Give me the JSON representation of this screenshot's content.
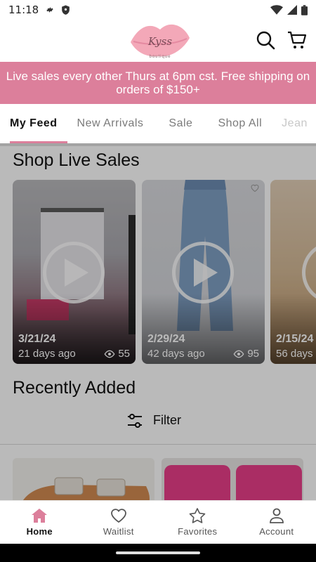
{
  "status_bar": {
    "time": "11:18"
  },
  "header": {
    "logo_text": "Kyss",
    "logo_subtext": "boutique"
  },
  "banner": {
    "text": "Live sales every other Thurs at 6pm cst. Free shipping on orders of $150+"
  },
  "tabs": [
    {
      "label": "My Feed",
      "active": true
    },
    {
      "label": "New Arrivals"
    },
    {
      "label": "Sale"
    },
    {
      "label": "Shop All"
    },
    {
      "label": "Jean"
    }
  ],
  "live_sales": {
    "title": "Shop Live Sales",
    "cards": [
      {
        "date": "3/21/24",
        "ago": "21 days ago",
        "views": "55"
      },
      {
        "date": "2/29/24",
        "ago": "42 days ago",
        "views": "95"
      },
      {
        "date": "2/15/24",
        "ago": "56 days"
      }
    ]
  },
  "recently_added": {
    "title": "Recently Added",
    "filter_label": "Filter"
  },
  "bottom_nav": [
    {
      "label": "Home",
      "icon": "home-icon",
      "active": true
    },
    {
      "label": "Waitlist",
      "icon": "heart-icon"
    },
    {
      "label": "Favorites",
      "icon": "star-icon"
    },
    {
      "label": "Account",
      "icon": "person-icon"
    }
  ],
  "colors": {
    "accent": "#dc7f9b",
    "overlay": "rgba(0,0,0,0.27)"
  }
}
